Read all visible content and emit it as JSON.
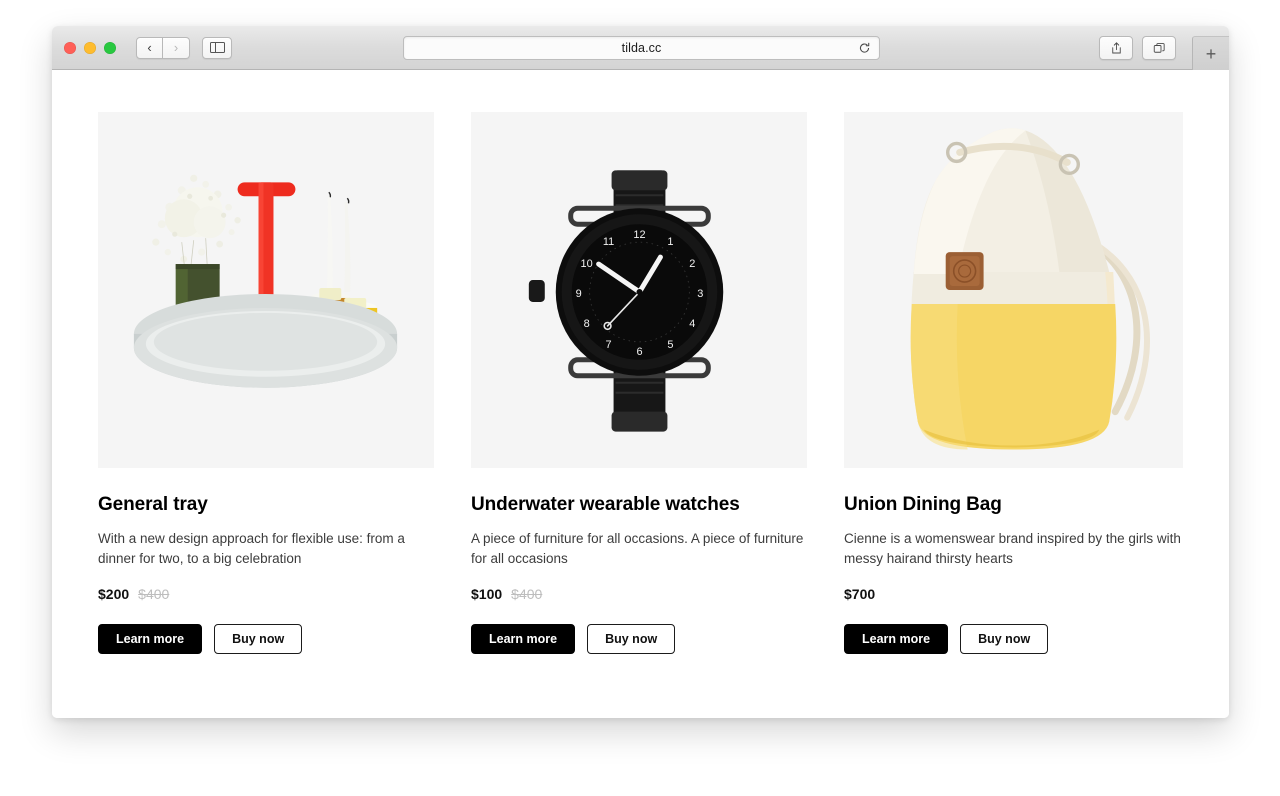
{
  "browser": {
    "url": "tilda.cc",
    "nav": {
      "back_label": "‹",
      "forward_label": "›",
      "sidebar_name": "sidebar-toggle",
      "reload_name": "reload-icon",
      "share_name": "share-icon",
      "tabs_name": "tab-overview-icon",
      "newtab_label": "+"
    },
    "window_controls": {
      "close": "close",
      "minimize": "minimize",
      "zoom": "zoom"
    }
  },
  "colors": {
    "accent": "#000000",
    "photo_bg": "#f5f5f5",
    "old_price": "#bdbdbd",
    "traffic_red": "#ff5f57",
    "traffic_yellow": "#febc2e",
    "traffic_green": "#28c840"
  },
  "products": [
    {
      "image_name": "general-tray-photo",
      "title": "General tray",
      "description": "With a new design approach for flexible use: from a dinner for two, to a big celebration",
      "price": "$200",
      "old_price": "$400",
      "primary_button": "Learn more",
      "secondary_button": "Buy now"
    },
    {
      "image_name": "watch-photo",
      "title": "Underwater wearable watches",
      "description": "A piece of furniture for all occasions. A piece of furniture for all occasions",
      "price": "$100",
      "old_price": "$400",
      "primary_button": "Learn more",
      "secondary_button": "Buy now"
    },
    {
      "image_name": "union-dining-bag-photo",
      "title": "Union Dining Bag",
      "description": "Cienne is a womenswear brand inspired by the girls with messy hairand thirsty hearts",
      "price": "$700",
      "old_price": "",
      "primary_button": "Learn more",
      "secondary_button": "Buy now"
    }
  ]
}
